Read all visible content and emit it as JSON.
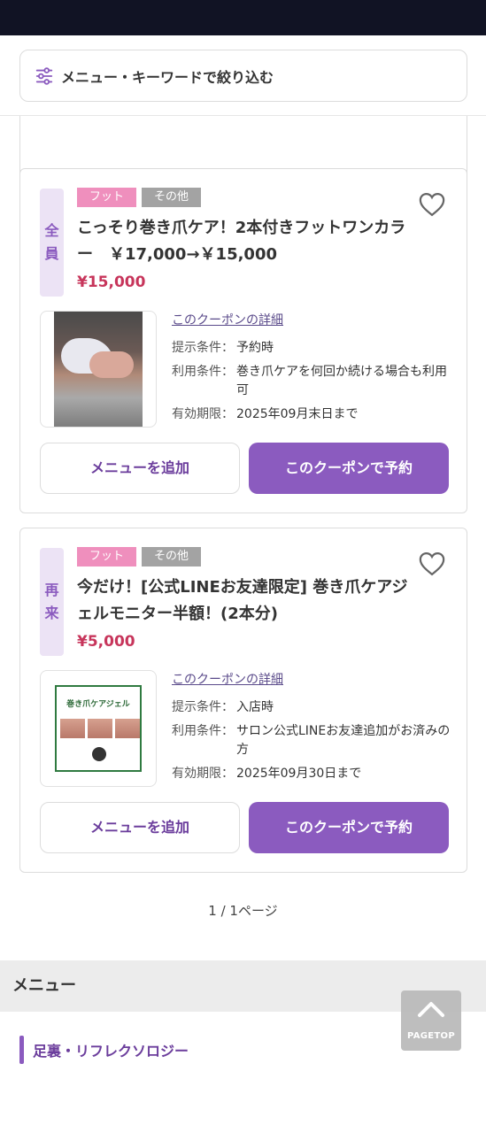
{
  "filter": {
    "label": "メニュー・キーワードで絞り込む",
    "icon": "sliders-icon"
  },
  "coupons": [
    {
      "target": [
        "全",
        "員"
      ],
      "tags": [
        "フット",
        "その他"
      ],
      "title": "こっそり巻き爪ケア！2本付きフットワンカラー　￥17,000→￥15,000",
      "price": "¥15,000",
      "detail_link": "このクーポンの詳細",
      "conditions": [
        {
          "key": "提示条件：",
          "value": "予約時"
        },
        {
          "key": "利用条件：",
          "value": "巻き爪ケアを何回か続ける場合も利用可"
        },
        {
          "key": "有効期限：",
          "value": "2025年09月末日まで"
        }
      ],
      "add_label": "メニューを追加",
      "book_label": "このクーポンで予約"
    },
    {
      "target": [
        "再",
        "来"
      ],
      "tags": [
        "フット",
        "その他"
      ],
      "title": "今だけ！[公式LINEお友達限定] 巻き爪ケアジェルモニター半額！(2本分)",
      "price": "¥5,000",
      "detail_link": "このクーポンの詳細",
      "image_text": "巻き爪ケアジェル",
      "conditions": [
        {
          "key": "提示条件：",
          "value": "入店時"
        },
        {
          "key": "利用条件：",
          "value": "サロン公式LINEお友達追加がお済みの方"
        },
        {
          "key": "有効期限：",
          "value": "2025年09月30日まで"
        }
      ],
      "add_label": "メニューを追加",
      "book_label": "このクーポンで予約"
    }
  ],
  "pager": "1 / 1ページ",
  "menu_section": {
    "heading": "メニュー",
    "items": [
      "足裏・リフレクソロジー"
    ]
  },
  "pagetop": {
    "label": "PAGETOP",
    "icon": "chevron-up-icon"
  },
  "colors": {
    "accent": "#8b5bbf",
    "price": "#c7355b",
    "tag_foot": "#ef8fbd",
    "tag_other": "#a3a3a3"
  }
}
